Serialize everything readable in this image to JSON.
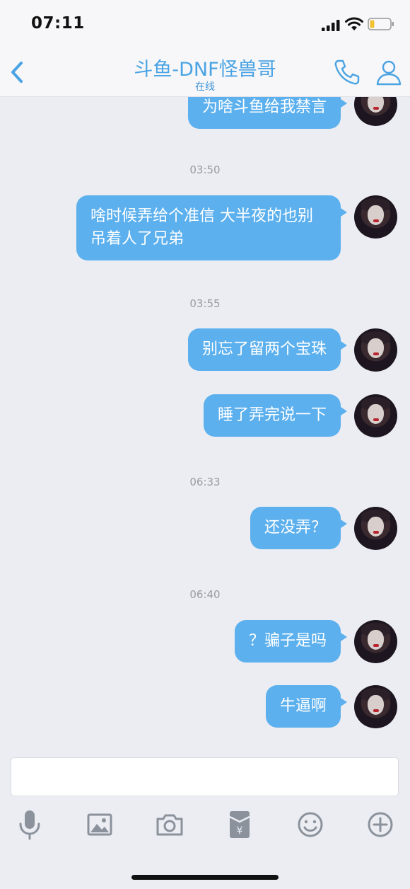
{
  "status_bar": {
    "time": "07:11"
  },
  "header": {
    "title": "斗鱼-DNF怪兽哥",
    "subtitle": "在线"
  },
  "messages": [
    {
      "type": "bubble",
      "text": "为啥斗鱼给我禁言"
    },
    {
      "type": "time",
      "text": "03:50"
    },
    {
      "type": "bubble",
      "text": "啥时候弄给个准信 大半夜的也别吊着人了兄弟"
    },
    {
      "type": "time",
      "text": "03:55"
    },
    {
      "type": "bubble",
      "text": "别忘了留两个宝珠"
    },
    {
      "type": "bubble",
      "text": "睡了弄完说一下"
    },
    {
      "type": "time",
      "text": "06:33"
    },
    {
      "type": "bubble",
      "text": "还没弄？"
    },
    {
      "type": "time",
      "text": "06:40"
    },
    {
      "type": "bubble",
      "text": "？骗子是吗"
    },
    {
      "type": "bubble",
      "text": "牛逼啊"
    }
  ],
  "input": {
    "value": "",
    "placeholder": ""
  },
  "toolbar": [
    "microphone-icon",
    "image-icon",
    "camera-icon",
    "red-packet-icon",
    "emoji-icon",
    "plus-icon"
  ],
  "colors": {
    "accent": "#4aa3e3",
    "bubble": "#5cb0ee",
    "background": "#ebedf2"
  }
}
